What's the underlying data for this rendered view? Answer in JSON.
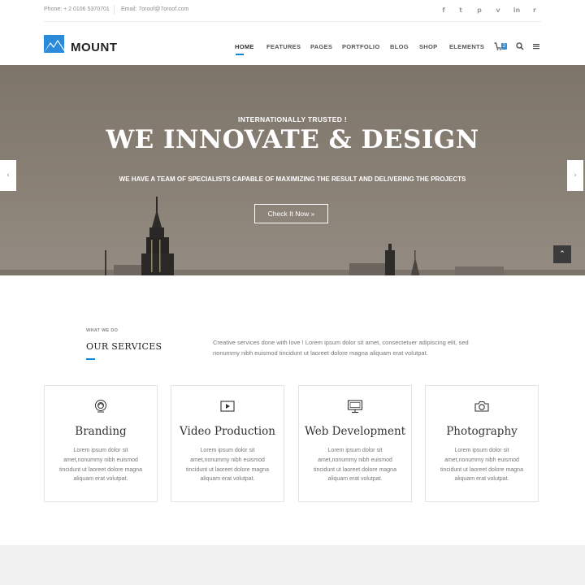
{
  "topbar": {
    "phone": "Phone: + 2 0106 5370701",
    "email": "Email: 7oroof@7oroof.com",
    "social": [
      {
        "icon": "facebook-icon",
        "glyph": "f"
      },
      {
        "icon": "twitter-icon",
        "glyph": "t"
      },
      {
        "icon": "pinterest-icon",
        "glyph": "p"
      },
      {
        "icon": "vimeo-icon",
        "glyph": "v"
      },
      {
        "icon": "linkedin-icon",
        "glyph": "in"
      },
      {
        "icon": "rss-icon",
        "glyph": "r"
      }
    ]
  },
  "header": {
    "logo": "MOUNT",
    "nav": [
      "HOME",
      "FEATURES",
      "PAGES",
      "PORTFOLIO",
      "BLOG",
      "SHOP",
      "ELEMENTS"
    ],
    "cart_count": "2",
    "accent": "#0e88d3"
  },
  "hero": {
    "kicker": "INTERNATIONALLY TRUSTED !",
    "title": "WE INNOVATE & DESIGN",
    "subtitle": "WE HAVE A TEAM OF SPECIALISTS CAPABLE OF MAXIMIZING THE RESULT AND DELIVERING THE PROJECTS",
    "button": "Check It Now  »",
    "prev": "‹",
    "next": "›",
    "scroll_top": "⌃"
  },
  "services": {
    "kicker": "WHAT WE DO",
    "title": "OUR SERVICES",
    "description": "Creative services done with love ! Lorem ipsum dolor sit amet, consectetuer adipiscing elit, sed nonummy nibh euismod tincidunt ut laoreet dolore magna aliquam erat volutpat.",
    "cards": [
      {
        "title": "Branding",
        "icon": "branding-icon",
        "text": "Lorem ipsum dolor sit amet,nonummy nibh euismod tincidunt ut laoreet dolore magna aliquam erat volutpat."
      },
      {
        "title": "Video Production",
        "icon": "video-play-icon",
        "text": "Lorem ipsum dolor sit amet,nonummy nibh euismod tincidunt ut laoreet dolore magna aliquam erat volutpat."
      },
      {
        "title": "Web Development",
        "icon": "monitor-icon",
        "text": "Lorem ipsum dolor sit amet,nonummy nibh euismod tincidunt ut laoreet dolore magna aliquam erat volutpat."
      },
      {
        "title": "Photography",
        "icon": "camera-icon",
        "text": "Lorem ipsum dolor sit amet,nonummy nibh euismod tincidunt ut laoreet dolore magna aliquam erat volutpat."
      }
    ]
  }
}
